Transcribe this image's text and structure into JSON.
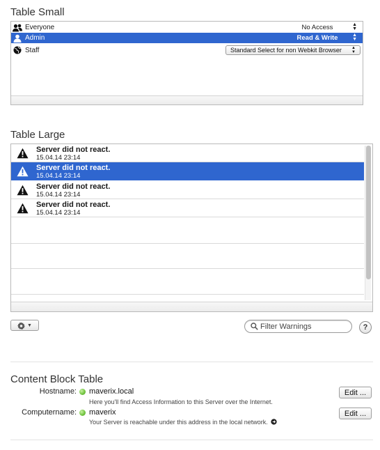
{
  "table_small": {
    "title": "Table Small",
    "rows": [
      {
        "icon": "group-icon",
        "name": "Everyone",
        "access": "No Access"
      },
      {
        "icon": "user-icon",
        "name": "Admin",
        "access": "Read & Write"
      },
      {
        "icon": "globe-icon",
        "name": "Staff",
        "access": "Standard Select for non Webkit Browser"
      }
    ],
    "selected_row": "Admin"
  },
  "table_large": {
    "title": "Table Large",
    "rows": [
      {
        "icon": "warning-icon",
        "title": "Server did not react.",
        "timestamp": "15.04.14 23:14"
      },
      {
        "icon": "warning-icon",
        "title": "Server did not react.",
        "timestamp": "15.04.14 23:14"
      },
      {
        "icon": "warning-icon",
        "title": "Server did not react.",
        "timestamp": "15.04.14 23:14"
      },
      {
        "icon": "warning-icon",
        "title": "Server did not react.",
        "timestamp": "15.04.14 23:14"
      }
    ],
    "selected_index": 1
  },
  "toolbar": {
    "gear_icon": "gear-icon",
    "search_placeholder": "Filter Warnings",
    "help_label": "?"
  },
  "content_block": {
    "title": "Content Block Table",
    "rows": [
      {
        "label": "Hostname:",
        "status_color": "#6fc23d",
        "value": "maverix.local",
        "description": "Here you'll find Access Information to this Server over the Internet.",
        "edit_label": "Edit ..."
      },
      {
        "label": "Computername:",
        "status_color": "#6fc23d",
        "value": "maverix",
        "description": "Your Server is reachable under this address in the local network.",
        "edit_label": "Edit ..."
      }
    ]
  },
  "colors": {
    "selection": "#2f66cf",
    "status_green": "#6fc23d"
  }
}
